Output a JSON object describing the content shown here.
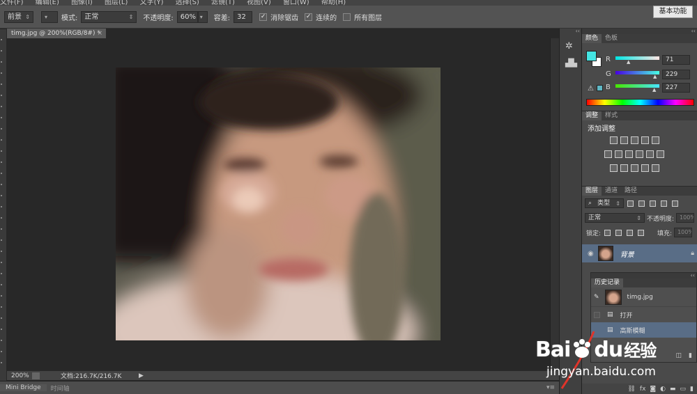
{
  "menubar": {
    "items": [
      "文件(F)",
      "编辑(E)",
      "图像(I)",
      "图层(L)",
      "文字(Y)",
      "选择(S)",
      "滤镜(T)",
      "视图(V)",
      "窗口(W)",
      "帮助(H)"
    ]
  },
  "options": {
    "preset": "前景",
    "mode_label": "模式:",
    "mode_value": "正常",
    "opacity_label": "不透明度:",
    "opacity_value": "60%",
    "tolerance_label": "容差:",
    "tolerance_value": "32",
    "antialias_label": "消除锯齿",
    "contiguous_label": "连续的",
    "all_layers_label": "所有图层",
    "workspace": "基本功能"
  },
  "document": {
    "tab_title": "timg.jpg @ 200%(RGB/8#) *",
    "close": "×"
  },
  "status": {
    "zoom": "200%",
    "doc_info": "文档:216.7K/216.7K"
  },
  "bottom_tabs": [
    "Mini Bridge",
    "时间轴"
  ],
  "color_panel": {
    "tabs": [
      "颜色",
      "色板"
    ],
    "fg_color": "#44e5e3",
    "bg_color": "#ffffff",
    "r_label": "R",
    "r": "71",
    "g_label": "G",
    "g": "229",
    "b_label": "B",
    "b": "227"
  },
  "adjustments_panel": {
    "tabs": [
      "调整",
      "样式"
    ],
    "title": "添加调整"
  },
  "layers_panel": {
    "tabs": [
      "图层",
      "通道",
      "路径"
    ],
    "filter_type": "类型",
    "blend_mode": "正常",
    "opacity_label": "不透明度:",
    "opacity_value": "100%",
    "lock_label": "锁定:",
    "fill_label": "填充:",
    "fill_value": "100%",
    "layer_name": "背景"
  },
  "history_panel": {
    "title": "历史记录",
    "snapshot": "timg.jpg",
    "states": [
      "打开",
      "高斯模糊"
    ]
  },
  "watermark": {
    "brand": "Bai",
    "brand2": "du",
    "cn": "经验",
    "url": "jingyan.baidu.com"
  }
}
